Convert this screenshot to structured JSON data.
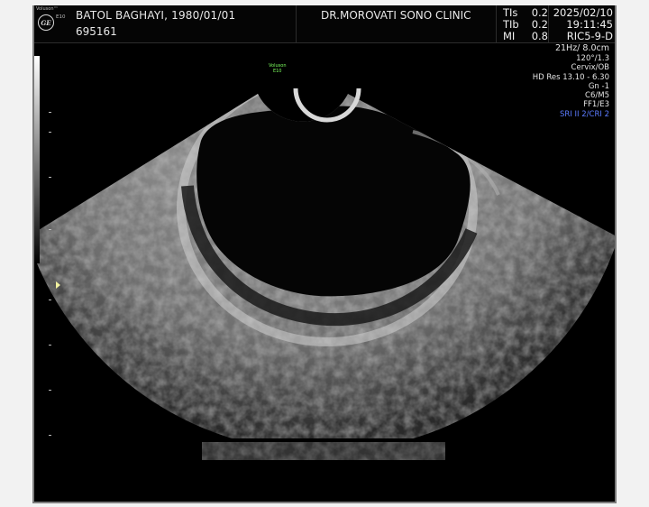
{
  "header": {
    "brand": "Voluson™",
    "model": "E10",
    "logo_text": "GE",
    "patient_name": "BATOL BAGHAYI,   1980/01/01",
    "patient_id": "695161",
    "clinic": "DR.MOROVATI SONO CLINIC",
    "params": [
      {
        "label": "TIs",
        "value": "0.2"
      },
      {
        "label": "TIb",
        "value": "0.2"
      },
      {
        "label": "MI",
        "value": "0.8"
      }
    ],
    "date": "2025/02/10",
    "time": "19:11:45",
    "probe": "RIC5-9-D"
  },
  "side_info": {
    "depth": "21Hz/ 8.0cm",
    "angle": "120°/1.3",
    "preset": "Cervix/OB",
    "hd_res": "HD Res 13.10 - 6.30",
    "gain": "Gn  -1",
    "map": "C6/M5",
    "filter": "FF1/E3",
    "sri": "SRI II 2/CRI 2"
  },
  "volume_label": {
    "line1": "Voluson",
    "line2": "E10"
  },
  "colors": {
    "background": "#000000",
    "frame": "#7c7c7c",
    "text": "#e8e8e8",
    "sri": "#5b7bff",
    "volume_label": "#7cff5e"
  }
}
